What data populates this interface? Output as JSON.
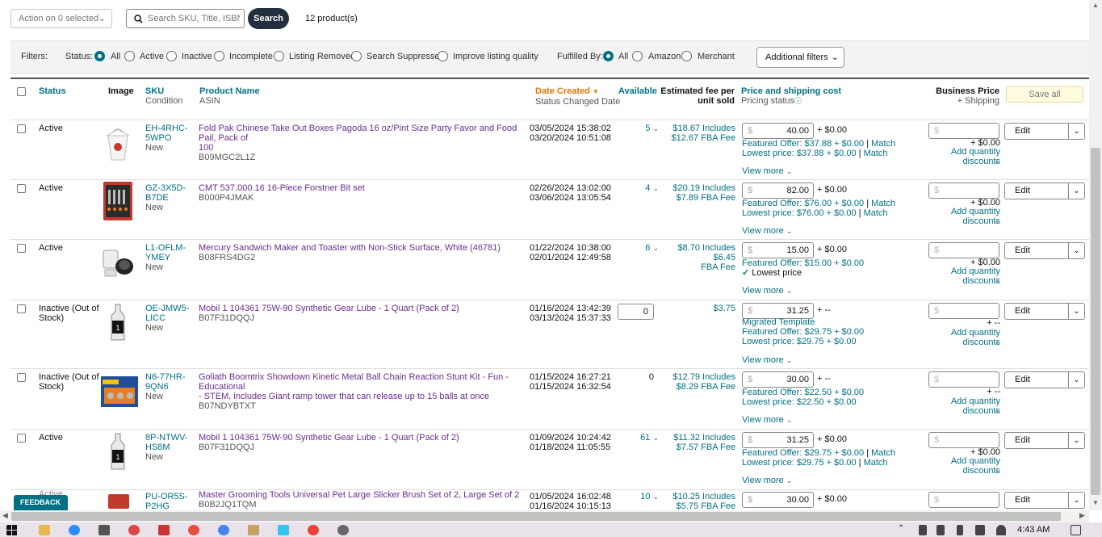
{
  "toolbar": {
    "action_label": "Action on 0 selected",
    "search_placeholder": "Search SKU, Title, ISBN, ASIN",
    "search_button": "Search",
    "product_count": "12 product(s)"
  },
  "filters": {
    "label": "Filters:",
    "status_label": "Status:",
    "status_options": [
      "All",
      "Active",
      "Inactive",
      "Incomplete",
      "Listing Removed",
      "Search Suppressed",
      "Improve listing quality"
    ],
    "status_selected": "All",
    "fulfilled_label": "Fulfilled By:",
    "fulfilled_options": [
      "All",
      "Amazon",
      "Merchant"
    ],
    "fulfilled_selected": "All",
    "additional_filters": "Additional filters"
  },
  "table": {
    "headers": {
      "status": "Status",
      "image": "Image",
      "sku": "SKU",
      "sku_sub": "Condition",
      "product_name": "Product Name",
      "product_sub": "ASIN",
      "date_created": "Date Created",
      "date_sub": "Status Changed Date",
      "available": "Available",
      "fee_line1": "Estimated fee per",
      "fee_line2": "unit sold",
      "price": "Price and shipping cost",
      "price_sub": "Pricing status",
      "business_price": "Business Price",
      "business_sub": "+ Shipping",
      "save_all": "Save all"
    },
    "common": {
      "view_more": "View more",
      "add_qty_discounts": "Add quantity discounts",
      "edit": "Edit",
      "match": "Match",
      "dollar": "$",
      "lowest_price": "Lowest price",
      "migrated_template": "Migrated Template"
    },
    "rows": [
      {
        "status": "Active",
        "sku1": "EH-4RHC-",
        "sku2": "5WPO",
        "condition": "New",
        "name1": "Fold Pak Chinese Take Out Boxes Pagoda 16 oz/Pint Size Party Favor and Food Pail, Pack of",
        "name2": "100",
        "asin": "B09MGC2L1Z",
        "date_created": "03/05/2024 15:38:02",
        "date_changed": "03/20/2024 10:51:08",
        "available": "5",
        "fee1": "$18.67 Includes",
        "fee2": "$12.67 FBA Fee",
        "price": "40.00",
        "shipping": "+ $0.00",
        "featured": "Featured Offer: $37.88 + $0.00",
        "lowest": "Lowest price: $37.88 + $0.00",
        "biz_ship": "+ $0.00"
      },
      {
        "status": "Active",
        "sku1": "GZ-3X5D-",
        "sku2": "B7DE",
        "condition": "New",
        "name1": "CMT 537.000.16 16-Piece Forstner Bit set",
        "name2": "",
        "asin": "B000P4JMAK",
        "date_created": "02/26/2024 13:02:00",
        "date_changed": "03/06/2024 13:05:54",
        "available": "4",
        "fee1": "$20.19 Includes",
        "fee2": "$7.89 FBA Fee",
        "price": "82.00",
        "shipping": "+ $0.00",
        "featured": "Featured Offer: $76.00 + $0.00",
        "lowest": "Lowest price: $76.00 + $0.00",
        "biz_ship": "+ $0.00"
      },
      {
        "status": "Active",
        "sku1": "L1-OFLM-",
        "sku2": "YMEY",
        "condition": "New",
        "name1": "Mercury Sandwich Maker and Toaster with Non-Stick Surface, White (46781)",
        "name2": "",
        "asin": "B08FRS4DG2",
        "date_created": "01/22/2024 10:38:00",
        "date_changed": "02/01/2024 12:49:58",
        "available": "6",
        "fee1": "$8.70 Includes $6.45",
        "fee2": "FBA Fee",
        "price": "15.00",
        "shipping": "+ $0.00",
        "featured": "Featured Offer: $15.00 + $0.00",
        "biz_ship": "+ $0.00"
      },
      {
        "status1": "Inactive (Out of",
        "status2": "Stock)",
        "sku1": "OE-JMW5-",
        "sku2": "LICC",
        "condition": "New",
        "name1": "Mobil 1 104361 75W-90 Synthetic Gear Lube - 1 Quart (Pack of 2)",
        "name2": "",
        "asin": "B07F31DQQJ",
        "date_created": "01/16/2024 13:42:39",
        "date_changed": "03/13/2024 15:37:33",
        "available": "0",
        "fee1": "$3.75",
        "fee2": "",
        "price": "31.25",
        "shipping": "+ --",
        "featured": "Featured Offer: $29.75 + $0.00",
        "lowest": "Lowest price: $29.75 + $0.00",
        "biz_ship": "+ --"
      },
      {
        "status1": "Inactive (Out of",
        "status2": "Stock)",
        "sku1": "N6-77HR-",
        "sku2": "9QN6",
        "condition": "New",
        "name1": "Goliath Boomtrix Showdown Kinetic Metal Ball Chain Reaction Stunt Kit - Fun - Educational",
        "name2": "- STEM, includes Giant ramp tower that can release up to 15 balls at once",
        "asin": "B07NDYBTXT",
        "date_created": "01/15/2024 16:27:21",
        "date_changed": "01/15/2024 16:32:54",
        "available": "0",
        "fee1": "$12.79 Includes",
        "fee2": "$8.29 FBA Fee",
        "price": "30.00",
        "shipping": "+ --",
        "featured": "Featured Offer: $22.50 + $0.00",
        "lowest": "Lowest price: $22.50 + $0.00",
        "biz_ship": "+ --"
      },
      {
        "status": "Active",
        "sku1": "8P-NTWV-",
        "sku2": "HS8M",
        "condition": "New",
        "name1": "Mobil 1 104361 75W-90 Synthetic Gear Lube - 1 Quart (Pack of 2)",
        "name2": "",
        "asin": "B07F31DQQJ",
        "date_created": "01/09/2024 10:24:42",
        "date_changed": "01/18/2024 11:05:55",
        "available": "61",
        "fee1": "$11.32 Includes",
        "fee2": "$7.57 FBA Fee",
        "price": "31.25",
        "shipping": "+ $0.00",
        "featured": "Featured Offer: $29.75 + $0.00",
        "lowest": "Lowest price: $29.75 + $0.00",
        "biz_ship": "+ $0.00"
      },
      {
        "status": "Active",
        "sku1": "PU-OR5S-",
        "sku2": "P2HG",
        "condition": "",
        "name1": "Master Grooming Tools Universal Pet Large Slicker Brush Set of 2, Large Set of 2",
        "name2": "",
        "asin": "B0B2JQ1TQM",
        "date_created": "01/05/2024 16:02:48",
        "date_changed": "01/16/2024 10:15:13",
        "available": "10",
        "fee1": "$10.25 Includes",
        "fee2": "$5.75 FBA Fee",
        "price": "30.00",
        "shipping": "+ $0.00"
      }
    ]
  },
  "feedback": "FEEDBACK",
  "taskbar": {
    "time": "4:43 AM"
  },
  "colors": {
    "link": "#007185",
    "product_link": "#6b2c91",
    "sorted": "#e77600",
    "search_button": "#232f3e"
  }
}
